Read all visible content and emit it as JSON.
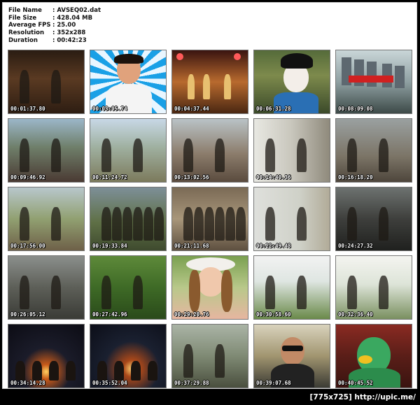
{
  "info": {
    "rows": [
      {
        "label": "File Name",
        "value": ": AVSEQ02.dat"
      },
      {
        "label": "File Size",
        "value": ": 428.04 MB"
      },
      {
        "label": "Average FPS",
        "value": ": 25.00"
      },
      {
        "label": "Resolution",
        "value": ": 352x288"
      },
      {
        "label": "Duration",
        "value": ": 00:42:23"
      }
    ]
  },
  "thumbnails": [
    {
      "time": "00:01:37.80",
      "scene": "interior-restaurant"
    },
    {
      "time": "00:03:05.74",
      "scene": "man-portrait-blue-rays"
    },
    {
      "time": "00:04:37.44",
      "scene": "stage-dancers"
    },
    {
      "time": "00:06:31.28",
      "scene": "geisha-closeup"
    },
    {
      "time": "00:08:09.08",
      "scene": "city-skytrain"
    },
    {
      "time": "00:09:46.92",
      "scene": "group-seated"
    },
    {
      "time": "00:11:24.72",
      "scene": "soldier-hills"
    },
    {
      "time": "00:13:02.56",
      "scene": "man-rocky-hill"
    },
    {
      "time": "00:14:40.36",
      "scene": "man-closeup-window"
    },
    {
      "time": "00:16:18.20",
      "scene": "man-rocks"
    },
    {
      "time": "00:17:56.00",
      "scene": "fight-hillside"
    },
    {
      "time": "00:19:33.84",
      "scene": "group-field"
    },
    {
      "time": "00:21:11.68",
      "scene": "crowd-ladies"
    },
    {
      "time": "00:22:49.48",
      "scene": "office-woman"
    },
    {
      "time": "00:24:27.32",
      "scene": "dark-alley"
    },
    {
      "time": "00:26:05.12",
      "scene": "temple-sign"
    },
    {
      "time": "00:27:42.96",
      "scene": "green-forest"
    },
    {
      "time": "00:29:20.76",
      "scene": "woman-hat-portrait"
    },
    {
      "time": "00:30:58.60",
      "scene": "couple-field"
    },
    {
      "time": "00:32:36.40",
      "scene": "woman-hat-field"
    },
    {
      "time": "00:34:14.28",
      "scene": "night-fire"
    },
    {
      "time": "00:35:52.04",
      "scene": "campfire-group"
    },
    {
      "time": "00:37:29.88",
      "scene": "kitchen-interior"
    },
    {
      "time": "00:39:07.68",
      "scene": "man-sunglasses"
    },
    {
      "time": "00:40:45.52",
      "scene": "green-costume"
    }
  ],
  "footer": "[775x725] http://upic.me/",
  "colors": {
    "panel_bg": "#ffffff",
    "page_bg": "#000000",
    "timestamp": "#ffffff"
  }
}
